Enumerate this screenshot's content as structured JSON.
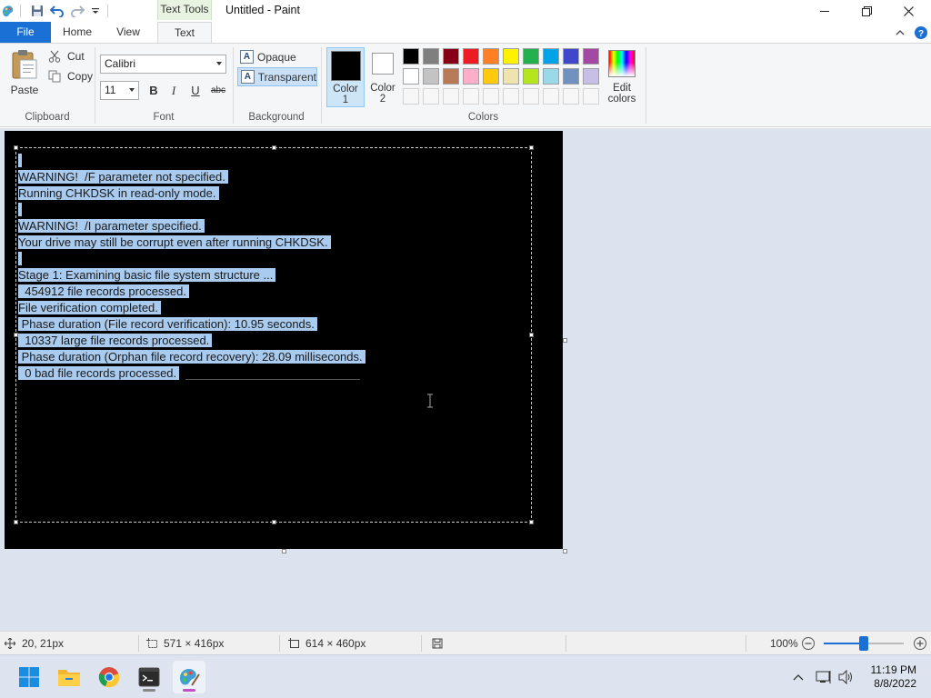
{
  "window": {
    "title": "Untitled - Paint",
    "context_tab": "Text Tools"
  },
  "tabs": {
    "file": "File",
    "home": "Home",
    "view": "View",
    "text": "Text"
  },
  "ribbon": {
    "clipboard": {
      "paste": "Paste",
      "cut": "Cut",
      "copy": "Copy",
      "group": "Clipboard"
    },
    "font": {
      "family": "Calibri",
      "size": "11",
      "bold": "B",
      "italic": "I",
      "underline": "U",
      "strike": "abc",
      "group": "Font"
    },
    "background": {
      "opaque": "Opaque",
      "transparent": "Transparent",
      "group": "Background"
    },
    "colors": {
      "color1_label_a": "Color",
      "color1_label_b": "1",
      "color2_label_a": "Color",
      "color2_label_b": "2",
      "edit_a": "Edit",
      "edit_b": "colors",
      "group": "Colors",
      "color1": "#000000",
      "color2": "#ffffff",
      "palette_row1": [
        "#000000",
        "#7f7f7f",
        "#880015",
        "#ed1c24",
        "#ff7f27",
        "#fff200",
        "#22b14c",
        "#00a2e8",
        "#3f48cc",
        "#a349a4"
      ],
      "palette_row2": [
        "#ffffff",
        "#c3c3c3",
        "#b97a57",
        "#ffaec9",
        "#ffc90e",
        "#efe4b0",
        "#b5e61d",
        "#99d9ea",
        "#7092be",
        "#c8bfe7"
      ]
    }
  },
  "canvas": {
    "text_lines": [
      "",
      "WARNING!  /F parameter not specified.",
      "Running CHKDSK in read-only mode.",
      "",
      "WARNING!  /I parameter specified.",
      "Your drive may still be corrupt even after running CHKDSK.",
      "",
      "Stage 1: Examining basic file system structure ...",
      "  454912 file records processed.",
      "File verification completed.",
      " Phase duration (File record verification): 10.95 seconds.",
      "  10337 large file records processed.",
      " Phase duration (Orphan file record recovery): 28.09 milliseconds.",
      "  0 bad file records processed."
    ]
  },
  "status": {
    "cursor": "20, 21px",
    "selection": "571 × 416px",
    "image_size": "614 × 460px",
    "zoom": "100%",
    "zoom_percent": 100
  },
  "taskbar": {
    "apps": [
      "start-icon",
      "file-explorer-icon",
      "chrome-icon",
      "terminal-icon",
      "paint-icon"
    ],
    "time": "11:19 PM",
    "date": "8/8/2022"
  }
}
